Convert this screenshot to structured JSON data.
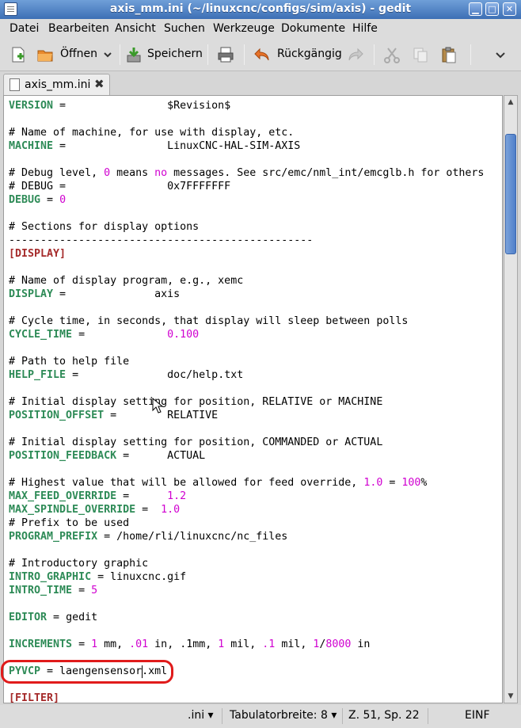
{
  "window": {
    "title": "axis_mm.ini (~/linuxcnc/configs/sim/axis) - gedit"
  },
  "menu": [
    "Datei",
    "Bearbeiten",
    "Ansicht",
    "Suchen",
    "Werkzeuge",
    "Dokumente",
    "Hilfe"
  ],
  "toolbar": {
    "open_label": "Öffnen",
    "save_label": "Speichern",
    "undo_label": "Rückgängig"
  },
  "tab": {
    "label": "axis_mm.ini"
  },
  "code_lines": [
    [
      {
        "t": "VERSION",
        "c": "k"
      },
      {
        "t": " =                $Revision$",
        "c": "c"
      }
    ],
    [],
    [
      {
        "t": "# Name of machine, for use with display, etc.",
        "c": "c"
      }
    ],
    [
      {
        "t": "MACHINE",
        "c": "k"
      },
      {
        "t": " =                LinuxCNC-HAL-SIM-AXIS",
        "c": "c"
      }
    ],
    [],
    [
      {
        "t": "# Debug level, ",
        "c": "c"
      },
      {
        "t": "0",
        "c": "n"
      },
      {
        "t": " means ",
        "c": "c"
      },
      {
        "t": "no",
        "c": "n"
      },
      {
        "t": " messages. See src/emc/nml_int/emcglb.h for others",
        "c": "c"
      }
    ],
    [
      {
        "t": "# DEBUG =                0x7FFFFFFF",
        "c": "c"
      }
    ],
    [
      {
        "t": "DEBUG",
        "c": "k"
      },
      {
        "t": " = ",
        "c": "c"
      },
      {
        "t": "0",
        "c": "n"
      }
    ],
    [],
    [
      {
        "t": "# Sections for display options",
        "c": "c"
      }
    ],
    [
      {
        "t": "------------------------------------------------",
        "c": "c"
      }
    ],
    [
      {
        "t": "[DISPLAY]",
        "c": "s"
      }
    ],
    [],
    [
      {
        "t": "# Name of display program, e.g., xemc",
        "c": "c"
      }
    ],
    [
      {
        "t": "DISPLAY",
        "c": "k"
      },
      {
        "t": " =              axis",
        "c": "c"
      }
    ],
    [],
    [
      {
        "t": "# Cycle time, in seconds, that display will sleep between polls",
        "c": "c"
      }
    ],
    [
      {
        "t": "CYCLE_TIME",
        "c": "k"
      },
      {
        "t": " =             ",
        "c": "c"
      },
      {
        "t": "0.100",
        "c": "n"
      }
    ],
    [],
    [
      {
        "t": "# Path to help file",
        "c": "c"
      }
    ],
    [
      {
        "t": "HELP_FILE",
        "c": "k"
      },
      {
        "t": " =              doc/help.txt",
        "c": "c"
      }
    ],
    [],
    [
      {
        "t": "# Initial display setting for position, RELATIVE or MACHINE",
        "c": "c"
      }
    ],
    [
      {
        "t": "POSITION_OFFSET",
        "c": "k"
      },
      {
        "t": " =        RELATIVE",
        "c": "c"
      }
    ],
    [],
    [
      {
        "t": "# Initial display setting for position, COMMANDED or ACTUAL",
        "c": "c"
      }
    ],
    [
      {
        "t": "POSITION_FEEDBACK",
        "c": "k"
      },
      {
        "t": " =      ACTUAL",
        "c": "c"
      }
    ],
    [],
    [
      {
        "t": "# Highest value that will be allowed for feed override, ",
        "c": "c"
      },
      {
        "t": "1.0",
        "c": "n"
      },
      {
        "t": " = ",
        "c": "c"
      },
      {
        "t": "100",
        "c": "n"
      },
      {
        "t": "%",
        "c": "c"
      }
    ],
    [
      {
        "t": "MAX_FEED_OVERRIDE",
        "c": "k"
      },
      {
        "t": " =      ",
        "c": "c"
      },
      {
        "t": "1.2",
        "c": "n"
      }
    ],
    [
      {
        "t": "MAX_SPINDLE_OVERRIDE",
        "c": "k"
      },
      {
        "t": " =  ",
        "c": "c"
      },
      {
        "t": "1.0",
        "c": "n"
      }
    ],
    [
      {
        "t": "# Prefix to be used",
        "c": "c"
      }
    ],
    [
      {
        "t": "PROGRAM_PREFIX",
        "c": "k"
      },
      {
        "t": " = /home/rli/linuxcnc/nc_files",
        "c": "c"
      }
    ],
    [],
    [
      {
        "t": "# Introductory graphic",
        "c": "c"
      }
    ],
    [
      {
        "t": "INTRO_GRAPHIC",
        "c": "k"
      },
      {
        "t": " = linuxcnc.gif",
        "c": "c"
      }
    ],
    [
      {
        "t": "INTRO_TIME",
        "c": "k"
      },
      {
        "t": " = ",
        "c": "c"
      },
      {
        "t": "5",
        "c": "n"
      }
    ],
    [],
    [
      {
        "t": "EDITOR",
        "c": "k"
      },
      {
        "t": " = gedit",
        "c": "c"
      }
    ],
    [],
    [
      {
        "t": "INCREMENTS",
        "c": "k"
      },
      {
        "t": " = ",
        "c": "c"
      },
      {
        "t": "1",
        "c": "n"
      },
      {
        "t": " mm, ",
        "c": "c"
      },
      {
        "t": ".01",
        "c": "n"
      },
      {
        "t": " in, .1mm, ",
        "c": "c"
      },
      {
        "t": "1",
        "c": "n"
      },
      {
        "t": " mil, ",
        "c": "c"
      },
      {
        "t": ".1",
        "c": "n"
      },
      {
        "t": " mil, ",
        "c": "c"
      },
      {
        "t": "1",
        "c": "n"
      },
      {
        "t": "/",
        "c": "c"
      },
      {
        "t": "8000",
        "c": "n"
      },
      {
        "t": " in",
        "c": "c"
      }
    ],
    [],
    [
      {
        "t": "PYVCP",
        "c": "k"
      },
      {
        "t": " = laengensensor.xml",
        "c": "c"
      }
    ],
    [],
    [
      {
        "t": "[FILTER]",
        "c": "s"
      }
    ]
  ],
  "status": {
    "filetype": ".ini",
    "tab_width": "Tabulatorbreite: 8",
    "position": "Z. 51, Sp. 22",
    "mode": "EINF"
  },
  "colors": {
    "keyword": "#2e8b57",
    "section": "#a52a2a",
    "number": "#d000d0",
    "highlight": "#e01b1b"
  }
}
